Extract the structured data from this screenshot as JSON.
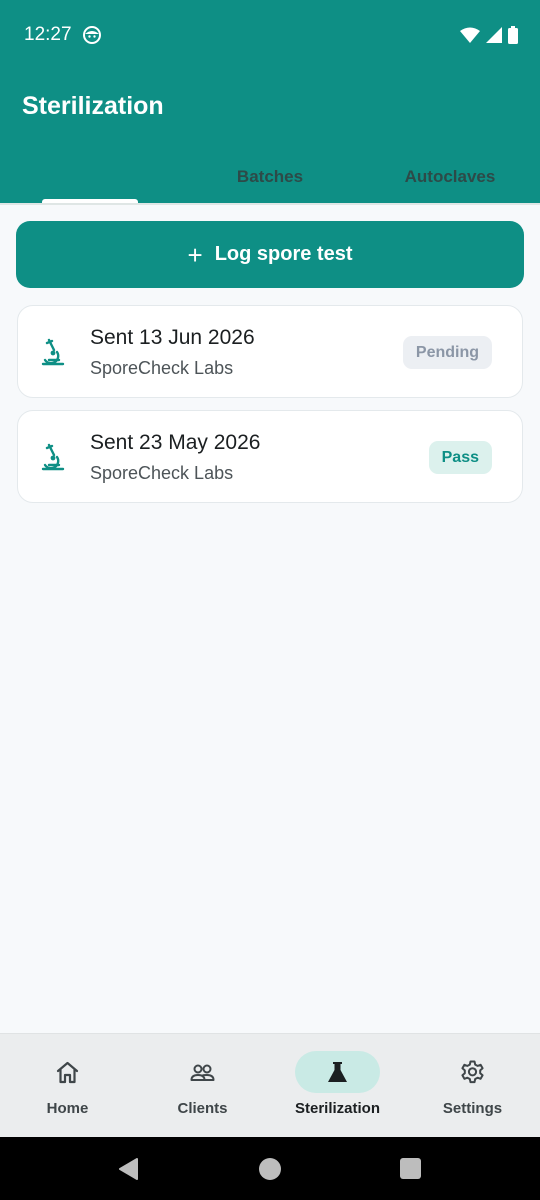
{
  "status_bar": {
    "time": "12:27",
    "icons": [
      "face-notification-icon",
      "wifi-icon",
      "signal-icon",
      "battery-icon"
    ]
  },
  "header": {
    "title": "Sterilization",
    "tabs": [
      {
        "label": "",
        "active": true
      },
      {
        "label": "Batches",
        "active": false
      },
      {
        "label": "Autoclaves",
        "active": false
      }
    ]
  },
  "actions": {
    "log_button_label": "Log spore test",
    "log_button_icon": "plus-icon"
  },
  "spore_tests": [
    {
      "title": "Sent 13 Jun 2026",
      "lab": "SporeCheck Labs",
      "status": "Pending",
      "icon": "microscope-icon"
    },
    {
      "title": "Sent 23 May 2026",
      "lab": "SporeCheck Labs",
      "status": "Pass",
      "icon": "microscope-icon"
    }
  ],
  "bottom_nav": {
    "items": [
      {
        "label": "Home",
        "icon": "home-icon",
        "active": false
      },
      {
        "label": "Clients",
        "icon": "people-icon",
        "active": false
      },
      {
        "label": "Sterilization",
        "icon": "flask-icon",
        "active": true
      },
      {
        "label": "Settings",
        "icon": "gear-icon",
        "active": false
      }
    ]
  },
  "colors": {
    "primary": "#0e8f85",
    "background": "#f7f9fb",
    "pending_badge_bg": "#eceff3",
    "pending_badge_text": "#8b96a6",
    "pass_badge_bg": "#dcf1ed",
    "pass_badge_text": "#0e8f85",
    "active_nav_pill": "#c9eae5"
  }
}
